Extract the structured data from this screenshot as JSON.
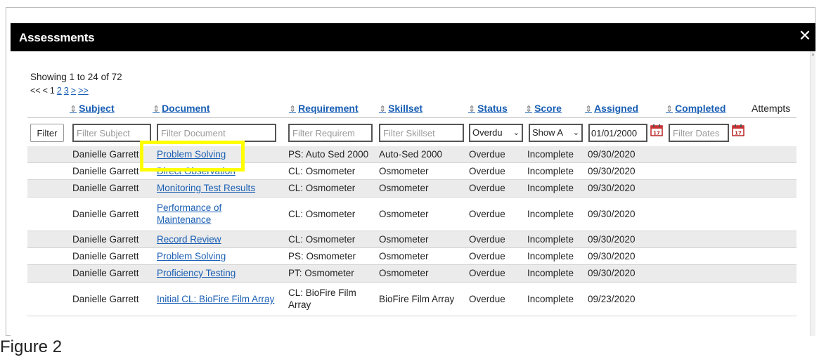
{
  "dialog": {
    "title": "Assessments",
    "close_icon": "close-icon"
  },
  "summary": {
    "showing": "Showing 1 to 24 of 72"
  },
  "pager": {
    "first": "<<",
    "prev": "<",
    "pages": [
      "1",
      "2",
      "3"
    ],
    "next": ">",
    "last": ">>"
  },
  "columns": {
    "subject": "Subject",
    "document": "Document",
    "requirement": "Requirement",
    "skillset": "Skillset",
    "status": "Status",
    "score": "Score",
    "assigned": "Assigned",
    "completed": "Completed",
    "attempts": "Attempts"
  },
  "filters": {
    "button": "Filter",
    "subject_placeholder": "Filter Subject",
    "document_placeholder": "Filter Document",
    "requirement_placeholder": "Filter Requirem",
    "skillset_placeholder": "Filter Skillset",
    "status_value": "Overdu",
    "score_value": "Show A",
    "assigned_value": "01/01/2000",
    "completed_placeholder": "Filter Dates",
    "calendar_icon": "calendar-icon"
  },
  "rows": [
    {
      "subject": "Danielle Garrett",
      "document": "Problem Solving",
      "requirement": "PS: Auto Sed 2000",
      "skillset": "Auto-Sed 2000",
      "status": "Overdue",
      "score": "Incomplete",
      "assigned": "09/30/2020"
    },
    {
      "subject": "Danielle Garrett",
      "document": "Direct Observation",
      "requirement": "CL: Osmometer",
      "skillset": "Osmometer",
      "status": "Overdue",
      "score": "Incomplete",
      "assigned": "09/30/2020"
    },
    {
      "subject": "Danielle Garrett",
      "document": "Monitoring Test Results",
      "requirement": "CL: Osmometer",
      "skillset": "Osmometer",
      "status": "Overdue",
      "score": "Incomplete",
      "assigned": "09/30/2020"
    },
    {
      "subject": "Danielle Garrett",
      "document": "Performance of Maintenance",
      "requirement": "CL: Osmometer",
      "skillset": "Osmometer",
      "status": "Overdue",
      "score": "Incomplete",
      "assigned": "09/30/2020"
    },
    {
      "subject": "Danielle Garrett",
      "document": "Record Review",
      "requirement": "CL: Osmometer",
      "skillset": "Osmometer",
      "status": "Overdue",
      "score": "Incomplete",
      "assigned": "09/30/2020"
    },
    {
      "subject": "Danielle Garrett",
      "document": "Problem Solving",
      "requirement": "PS: Osmometer",
      "skillset": "Osmometer",
      "status": "Overdue",
      "score": "Incomplete",
      "assigned": "09/30/2020"
    },
    {
      "subject": "Danielle Garrett",
      "document": "Proficiency Testing",
      "requirement": "PT: Osmometer",
      "skillset": "Osmometer",
      "status": "Overdue",
      "score": "Incomplete",
      "assigned": "09/30/2020"
    },
    {
      "subject": "Danielle Garrett",
      "document": "Initial CL: BioFire Film Array",
      "requirement": "CL: BioFire Film Array",
      "skillset": "BioFire Film Array",
      "status": "Overdue",
      "score": "Incomplete",
      "assigned": "09/23/2020"
    }
  ],
  "caption": "Figure 2",
  "colors": {
    "link": "#1a5fb4",
    "highlight": "#ffff00",
    "titlebar": "#000000",
    "alt_row": "#ebebeb"
  }
}
